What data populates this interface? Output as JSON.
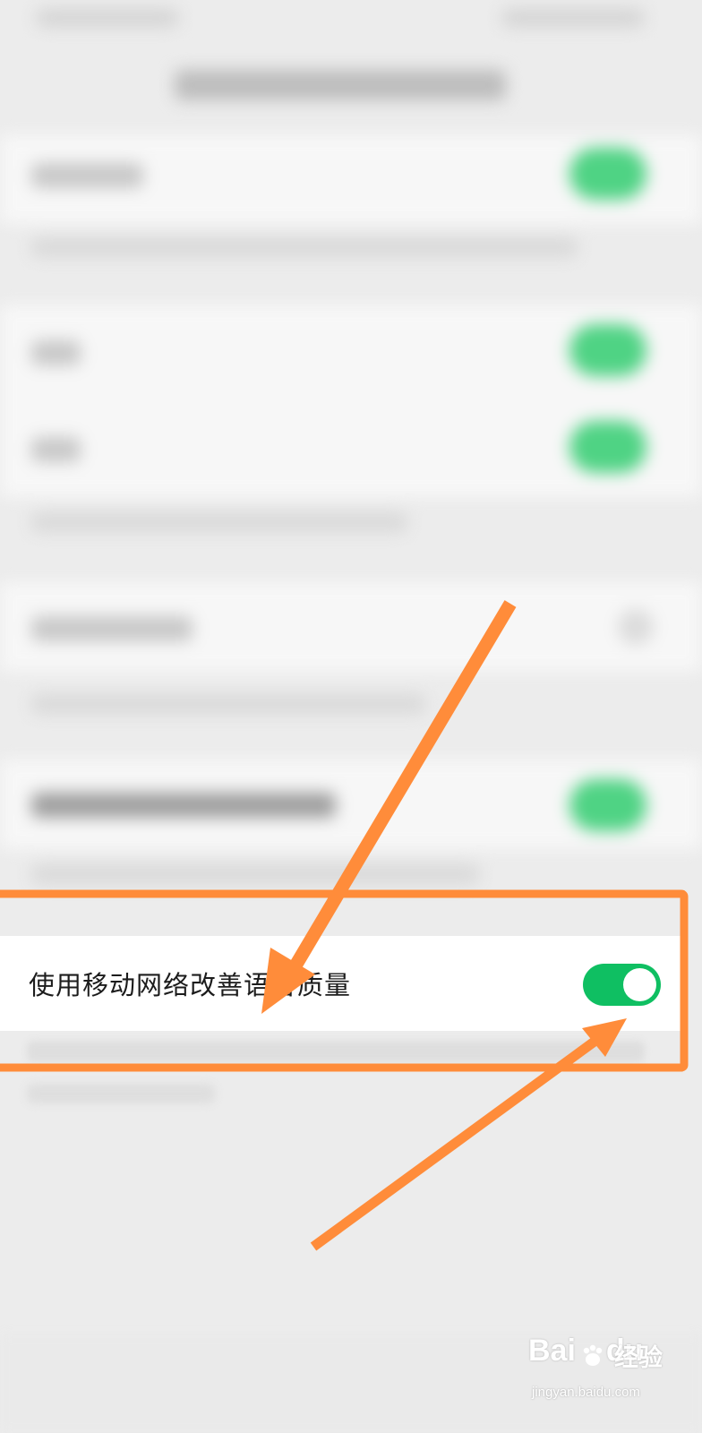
{
  "setting_row": {
    "label": "使用移动网络改善语音质量",
    "toggle_on": true
  },
  "colors": {
    "toggle_on": "#0fbf62",
    "highlight_frame": "#ff8c3a",
    "arrow": "#ff8c3a",
    "background": "#ececec",
    "row_background": "#ffffff"
  },
  "watermark": {
    "brand": "Bai",
    "brand_suffix": "du",
    "chinese": "经验",
    "url": "jingyan.baidu.com"
  }
}
